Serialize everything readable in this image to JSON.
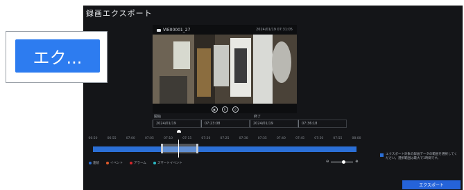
{
  "dialog": {
    "title": "録画エクスポート"
  },
  "video": {
    "camera_name": "VIE00001_27",
    "timestamp": "2024/01/19 07:31:05",
    "controls": [
      "snapshot",
      "pause",
      "rewind"
    ]
  },
  "range": {
    "start_label": "開始",
    "end_label": "終了",
    "start_date": "2024/01/19",
    "start_time": "07:23:08",
    "end_date": "2024/01/19",
    "end_time": "07:36:18"
  },
  "timeline": {
    "ticks": [
      "06:50",
      "06:55",
      "07:00",
      "07:05",
      "07:10",
      "07:15",
      "07:20",
      "07:25",
      "07:30",
      "07:35",
      "07:40",
      "07:45",
      "07:50",
      "07:55",
      "08:00"
    ]
  },
  "legend": [
    {
      "label": "連続",
      "color": "#2b6fd6"
    },
    {
      "label": "イベント",
      "color": "#e05a2b"
    },
    {
      "label": "アラーム",
      "color": "#d8262b"
    },
    {
      "label": "スマートイベント",
      "color": "#2bb8c4"
    }
  ],
  "note": {
    "text": "エクスポート対象の録画データの範囲を選択してください。選択範囲は最大で1時間です。"
  },
  "buttons": {
    "export": "エクスポート"
  },
  "callout": {
    "text": "エク..."
  }
}
